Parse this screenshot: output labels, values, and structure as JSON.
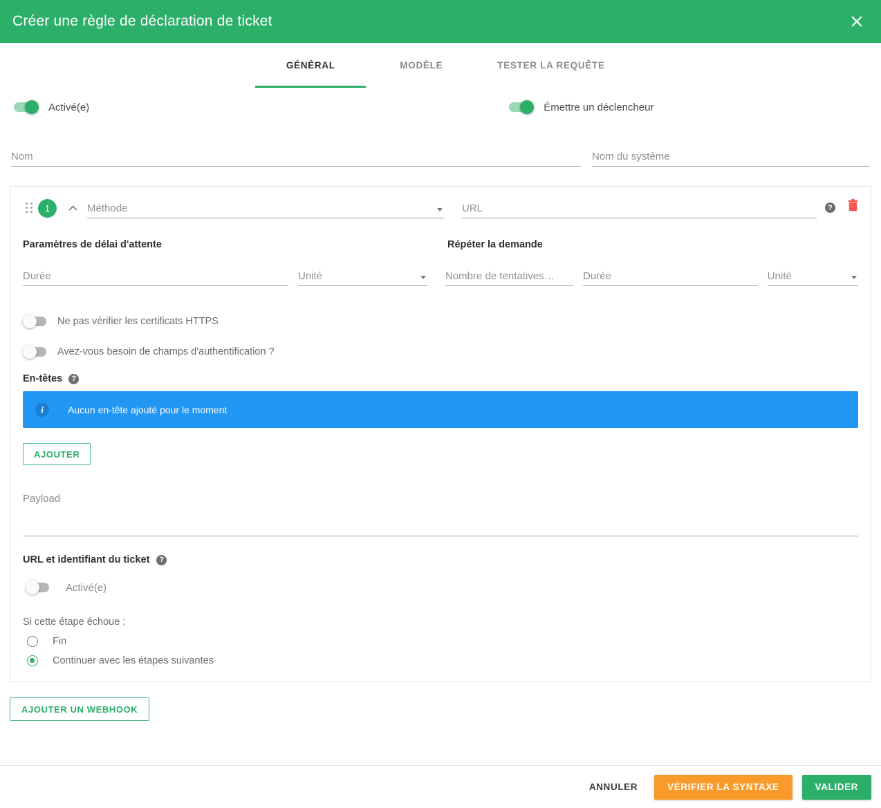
{
  "header": {
    "title": "Créer une règle de déclaration de ticket",
    "close_icon": "close-icon",
    "bg_color": "#2caf69"
  },
  "tabs": [
    {
      "label": "GÉNÉRAL",
      "active": true
    },
    {
      "label": "MODÈLE",
      "active": false
    },
    {
      "label": "TESTER LA REQUÊTE",
      "active": false
    }
  ],
  "top_toggles": {
    "enabled": {
      "label": "Activé(e)",
      "state": "on"
    },
    "emit_trigger": {
      "label": "Émettre un déclencheur",
      "state": "on"
    }
  },
  "name_fields": {
    "name": {
      "placeholder": "Nom",
      "value": ""
    },
    "system_name": {
      "placeholder": "Nom du système",
      "value": ""
    }
  },
  "step": {
    "number": "1",
    "drag_icon": "drag-handle-icon",
    "collapse_icon": "chevron-up-icon",
    "method": {
      "placeholder": "Méthode",
      "value": ""
    },
    "url": {
      "placeholder": "URL",
      "value": ""
    },
    "help_icon": "help-icon",
    "delete_icon": "trash-icon",
    "timeout": {
      "title": "Paramètres de délai d'attente",
      "duration": {
        "placeholder": "Durée",
        "value": ""
      },
      "unit": {
        "placeholder": "Unité",
        "value": ""
      }
    },
    "retry": {
      "title": "Répéter la demande",
      "attempts": {
        "placeholder": "Nombre de tentatives…",
        "value": ""
      },
      "duration": {
        "placeholder": "Durée",
        "value": ""
      },
      "unit": {
        "placeholder": "Unité",
        "value": ""
      }
    },
    "skip_https": {
      "label": "Ne pas vérifier les certificats HTTPS",
      "state": "off"
    },
    "need_auth": {
      "label": "Avez-vous besoin de champs d'authentification ?",
      "state": "off"
    },
    "headers": {
      "title": "En-têtes",
      "help_icon": "help-icon",
      "empty_message": "Aucun en-tête ajouté pour le moment",
      "info_icon": "info-icon",
      "banner_color": "#2196f3",
      "add_label": "AJOUTER"
    },
    "payload": {
      "label": "Payload",
      "value": ""
    },
    "ticket_url": {
      "title": "URL et identifiant du ticket",
      "help_icon": "help-icon",
      "toggle_label": "Activé(e)",
      "toggle_state": "off"
    },
    "on_failure": {
      "label": "Si cette étape échoue :",
      "options": [
        {
          "label": "Fin",
          "selected": false
        },
        {
          "label": "Continuer avec les étapes suivantes",
          "selected": true
        }
      ]
    }
  },
  "add_webhook_label": "AJOUTER UN WEBHOOK",
  "footer": {
    "cancel_label": "ANNULER",
    "check_syntax_label": "VÉRIFIER LA SYNTAXE",
    "validate_label": "VALIDER",
    "check_syntax_color": "#f89b2b",
    "validate_color": "#2caf69"
  }
}
